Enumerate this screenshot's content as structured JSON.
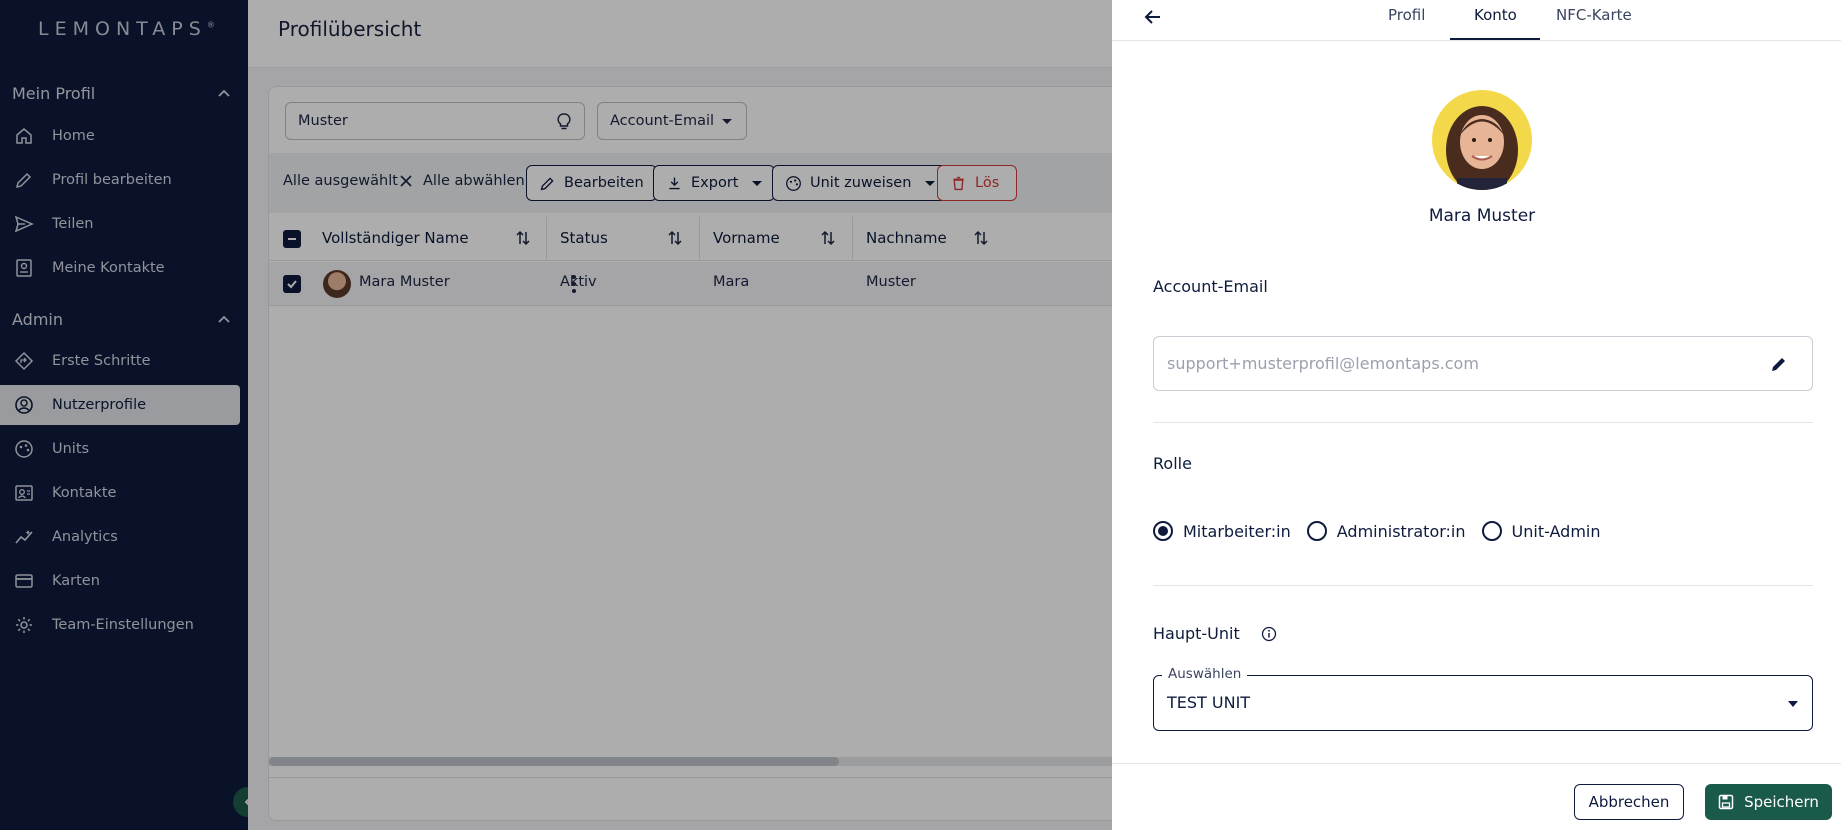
{
  "brand": {
    "logo": "LEMONTAPS",
    "reg": "®"
  },
  "sidebar": {
    "section_profile": "Mein Profil",
    "section_admin": "Admin",
    "profile_items": [
      {
        "label": "Home",
        "icon": "home-icon"
      },
      {
        "label": "Profil bearbeiten",
        "icon": "pencil-icon"
      },
      {
        "label": "Teilen",
        "icon": "send-icon"
      },
      {
        "label": "Meine Kontakte",
        "icon": "contact-card-icon"
      }
    ],
    "admin_items": [
      {
        "label": "Erste Schritte",
        "icon": "directions-icon"
      },
      {
        "label": "Nutzerprofile",
        "icon": "user-circle-icon"
      },
      {
        "label": "Units",
        "icon": "palette-icon"
      },
      {
        "label": "Kontakte",
        "icon": "contacts-icon"
      },
      {
        "label": "Analytics",
        "icon": "analytics-icon"
      },
      {
        "label": "Karten",
        "icon": "card-icon"
      },
      {
        "label": "Team-Einstellungen",
        "icon": "gear-icon"
      }
    ],
    "active": "Nutzerprofile"
  },
  "header": {
    "title": "Profilübersicht"
  },
  "filters": {
    "search_value": "Muster",
    "field_select": "Account-Email"
  },
  "toolbar": {
    "all_selected": "Alle ausgewählt",
    "deselect_all": "Alle abwählen",
    "edit": "Bearbeiten",
    "export": "Export",
    "assign_unit": "Unit zuweisen",
    "delete": "Lös"
  },
  "table": {
    "columns": [
      "Vollständiger Name",
      "Status",
      "Vorname",
      "Nachname"
    ],
    "rows": [
      {
        "full_name": "Mara Muster",
        "status": "Aktiv",
        "first": "Mara",
        "last": "Muster"
      }
    ]
  },
  "panel": {
    "tabs": [
      "Profil",
      "Konto",
      "NFC-Karte"
    ],
    "active_tab": "Konto",
    "user_name": "Mara Muster",
    "account_email_label": "Account-Email",
    "email_placeholder": "support+musterprofil@lemontaps.com",
    "role_label": "Rolle",
    "roles": [
      "Mitarbeiter:in",
      "Administrator:in",
      "Unit-Admin"
    ],
    "selected_role": "Mitarbeiter:in",
    "main_unit_label": "Haupt-Unit",
    "select_legend": "Auswählen",
    "select_value": "TEST UNIT",
    "cancel": "Abbrechen",
    "save": "Speichern"
  },
  "colors": {
    "sidebar_bg": "#0e1b3d",
    "accent": "#1a5a4b",
    "danger": "#d23a3a"
  }
}
